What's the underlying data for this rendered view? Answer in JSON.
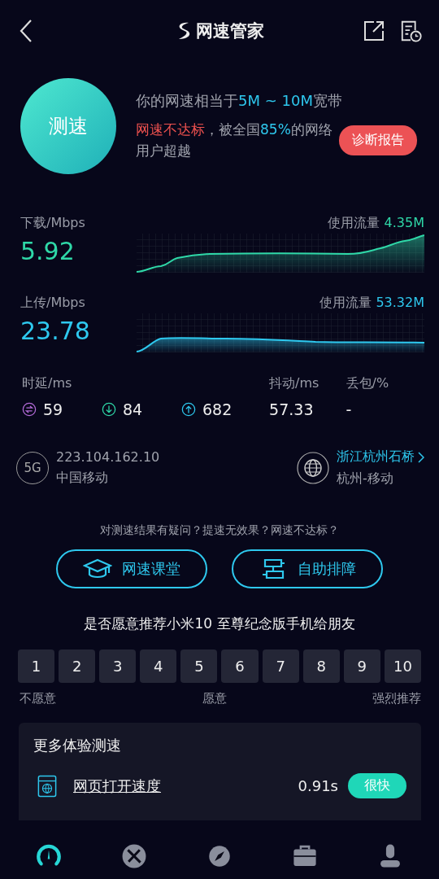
{
  "header": {
    "title": "网速管家"
  },
  "summary": {
    "button": "测速",
    "line1": "你的网速相当于**5M ~ 10M**宽带",
    "status": "网速不达标",
    "line2_rest": "，被全国**85%**的网络用户超越",
    "report_button": "诊断报告"
  },
  "speeds": [
    {
      "kind": "download",
      "label": "下载/Mbps",
      "value": "5.92",
      "usage_label": "使用流量",
      "usage": "4.35M"
    },
    {
      "kind": "upload",
      "label": "上传/Mbps",
      "value": "23.78",
      "usage_label": "使用流量",
      "usage": "53.32M"
    }
  ],
  "latency": {
    "label": "时延/ms",
    "items": [
      {
        "kind": "ping",
        "value": "59"
      },
      {
        "kind": "down",
        "value": "84"
      },
      {
        "kind": "up",
        "value": "682"
      }
    ]
  },
  "jitter": {
    "label": "抖动/ms",
    "value": "57.33"
  },
  "loss": {
    "label": "丢包/%",
    "value": "-"
  },
  "network": {
    "badge": "5G",
    "ip": "223.104.162.10",
    "carrier": "中国移动",
    "server": "浙江杭州石桥",
    "server_carrier": "杭州-移动"
  },
  "help": {
    "question": "对测速结果有疑问？提速无效果？网速不达标？",
    "buttons": [
      {
        "kind": "class",
        "label": "网速课堂"
      },
      {
        "kind": "fix",
        "label": "自助排障"
      }
    ]
  },
  "rating": {
    "question": "是否愿意推荐小米10 至尊纪念版手机给朋友",
    "scores": [
      "1",
      "2",
      "3",
      "4",
      "5",
      "6",
      "7",
      "8",
      "9",
      "10"
    ],
    "labels": [
      "不愿意",
      "愿意",
      "强烈推荐"
    ]
  },
  "more": {
    "title": "更多体验测速",
    "items": [
      {
        "name": "网页打开速度",
        "time": "0.91s",
        "verdict": "很快"
      }
    ]
  },
  "tabs": [
    {
      "kind": "speed",
      "selected": true
    },
    {
      "kind": "repair",
      "selected": false
    },
    {
      "kind": "discover",
      "selected": false
    },
    {
      "kind": "tools",
      "selected": false
    },
    {
      "kind": "user",
      "selected": false
    }
  ]
}
